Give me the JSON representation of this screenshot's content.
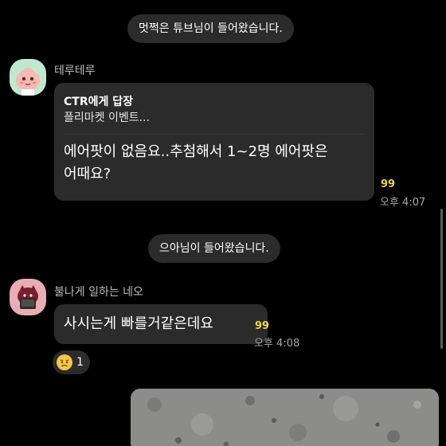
{
  "system_messages": [
    "멋쩍은 튜브님이 들어왔습니다.",
    "으아님이 들어왔습니다."
  ],
  "messages": [
    {
      "sender": "테루테루",
      "avatar_icon": "peach-character-icon",
      "reply_to": "CTR에게 답장",
      "reply_quote": "플리마켓 이벤트...",
      "text_line1": "에어팟이 없음요..추첨해서 1~2명 에어팟은",
      "text_line2": "어때요?",
      "unread_count": "99",
      "time": "오후 4:07"
    },
    {
      "sender": "불나게 일하는 네오",
      "avatar_icon": "neo-character-icon",
      "text": "사시는게 빠를거같은데요",
      "unread_count": "99",
      "time": "오후 4:08",
      "reaction_icon": "sad-face-icon",
      "reaction_count": "1"
    }
  ],
  "colors": {
    "background": "#000000",
    "bubble": "#2b2b2b",
    "unread_count": "#f0d64a",
    "time": "#a8a8a8"
  }
}
